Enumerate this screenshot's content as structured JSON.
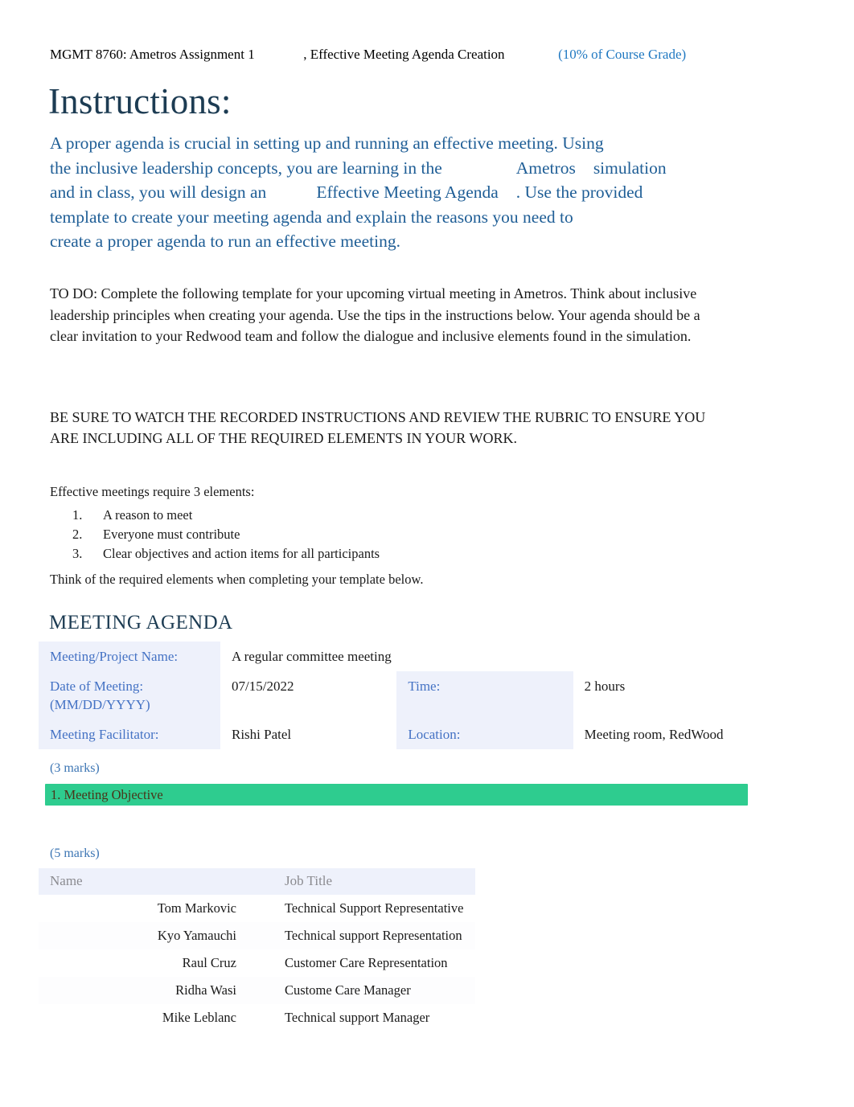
{
  "header": {
    "course": "MGMT 8760: Ametros Assignment 1",
    "assignment_title": ", Effective Meeting Agenda Creation",
    "weight": "(10% of Course Grade)",
    "weight_color": "#1f78c1"
  },
  "instructions": {
    "title": "Instructions:",
    "title_color": "#1d3c53",
    "intro_color": "#1f5e96",
    "intro": {
      "line1": "A proper agenda is crucial in setting up and running an effective meeting. Using",
      "line2a": "the inclusive leadership concepts, you are learning in the",
      "line2b": "Ametros",
      "line2c": "simulation",
      "line3a": "and in class, you will design an",
      "line3b": "Effective Meeting Agenda",
      "line3c": ". Use the provided",
      "line4": "template to create your meeting agenda and explain the reasons you need to",
      "line5": "create a proper agenda to run an effective meeting."
    },
    "todo": "TO DO: Complete the following template for your upcoming virtual meeting in Ametros. Think about inclusive leadership principles when creating your agenda. Use the tips in the instructions below. Your agenda should be a clear invitation to your Redwood team and follow the dialogue and inclusive elements found in the simulation.",
    "be_sure": "BE SURE TO WATCH THE RECORDED INSTRUCTIONS AND REVIEW THE RUBRIC TO ENSURE YOU ARE INCLUDING ALL OF THE REQUIRED ELEMENTS IN YOUR WORK.",
    "elements_intro": "Effective meetings require 3 elements:",
    "elements": [
      {
        "num": "1.",
        "text": "A reason to meet"
      },
      {
        "num": "2.",
        "text": "Everyone must contribute"
      },
      {
        "num": "3.",
        "text": "Clear objectives and action items for all participants"
      }
    ],
    "elements_outro": "Think of the required elements when completing your template below."
  },
  "agenda": {
    "heading": "MEETING AGENDA",
    "heading_color": "#1d3c53",
    "label_color": "#4472c4",
    "label_bg": "#eef1fb",
    "info": {
      "project_label": "Meeting/Project Name:",
      "project_value": "A regular committee meeting",
      "date_label": "Date of Meeting: (MM/DD/YYYY)",
      "date_value": "07/15/2022",
      "time_label": "Time:",
      "time_value": "2 hours",
      "facilitator_label": "Meeting Facilitator:",
      "facilitator_value": "Rishi Patel",
      "location_label": "Location:",
      "location_value": "Meeting room, RedWood"
    },
    "marks_3": "(3 marks)",
    "objective_bar_label": "1. Meeting Objective",
    "objective_bar_color": "#2ecc8f",
    "objective_bar_text_color": "#4a3418",
    "objective_value": "",
    "marks_5": "(5 marks)",
    "participants": {
      "columns": [
        "Name",
        "Job Title"
      ],
      "rows": [
        {
          "name": "Tom Markovic",
          "job": "Technical Support Representative"
        },
        {
          "name": "Kyo Yamauchi",
          "job": "Technical support Representation"
        },
        {
          "name": "Raul Cruz",
          "job": "Customer Care Representation"
        },
        {
          "name": "Ridha Wasi",
          "job": "Custome Care Manager"
        },
        {
          "name": "Mike Leblanc",
          "job": "Technical support Manager"
        }
      ]
    }
  }
}
